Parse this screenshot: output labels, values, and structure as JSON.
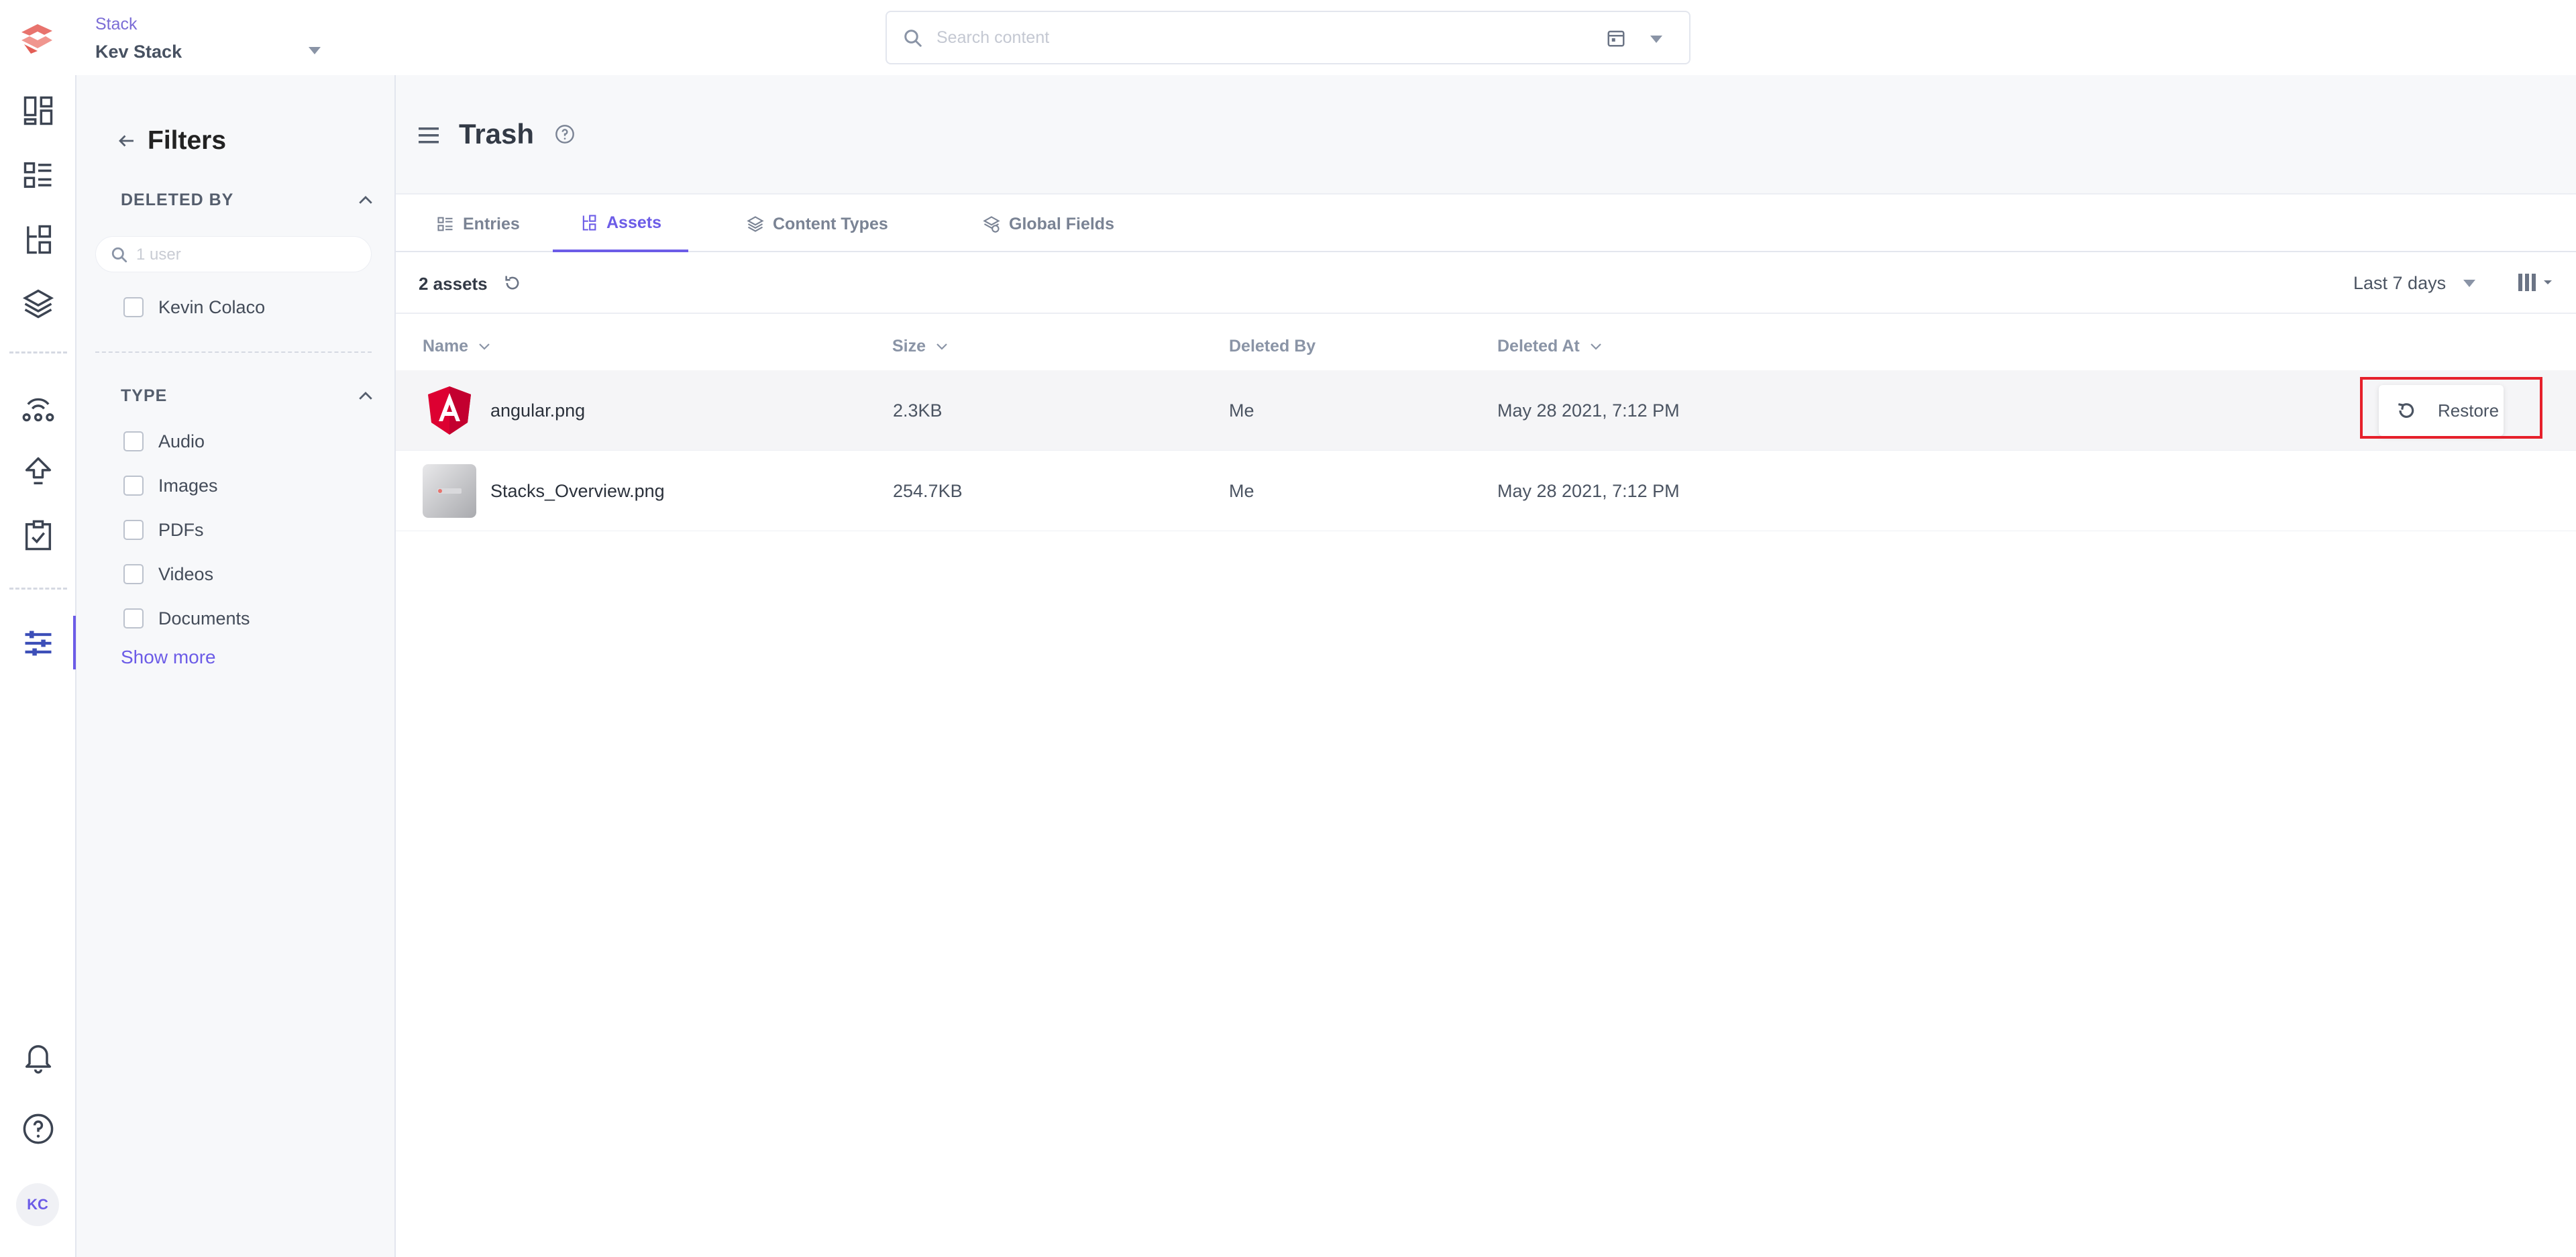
{
  "topbar": {
    "stack_caption": "Stack",
    "stack_name": "Kev Stack",
    "search_placeholder": "Search content"
  },
  "rail": {
    "items": [
      "dashboard-icon",
      "entries-icon",
      "assets-icon",
      "content-models-icon",
      "webhooks-icon",
      "publish-queue-icon",
      "tasks-icon",
      "settings-icon"
    ],
    "bottom": [
      "notifications-icon",
      "help-icon"
    ],
    "avatar_initials": "KC"
  },
  "filters": {
    "title": "Filters",
    "deleted_by": {
      "label": "DELETED BY",
      "search_placeholder": "1 user",
      "users": [
        "Kevin Colaco"
      ]
    },
    "type": {
      "label": "TYPE",
      "options": [
        "Audio",
        "Images",
        "PDFs",
        "Videos",
        "Documents"
      ]
    },
    "show_more": "Show more"
  },
  "page": {
    "title": "Trash",
    "tabs": [
      {
        "label": "Entries",
        "active": false
      },
      {
        "label": "Assets",
        "active": true
      },
      {
        "label": "Content Types",
        "active": false
      },
      {
        "label": "Global Fields",
        "active": false
      }
    ],
    "asset_count": "2 assets",
    "date_range": "Last 7 days"
  },
  "table": {
    "columns": {
      "name": "Name",
      "size": "Size",
      "deleted_by": "Deleted By",
      "deleted_at": "Deleted At"
    },
    "rows": [
      {
        "name": "angular.png",
        "size": "2.3KB",
        "deleted_by": "Me",
        "deleted_at": "May 28 2021, 7:12 PM",
        "thumb": "angular-logo"
      },
      {
        "name": "Stacks_Overview.png",
        "size": "254.7KB",
        "deleted_by": "Me",
        "deleted_at": "May 28 2021, 7:12 PM",
        "thumb": "image-preview"
      }
    ],
    "restore_label": "Restore"
  },
  "colors": {
    "accent": "#6c5ce7",
    "highlight": "#e6202b",
    "angular_red": "#dd0031"
  }
}
